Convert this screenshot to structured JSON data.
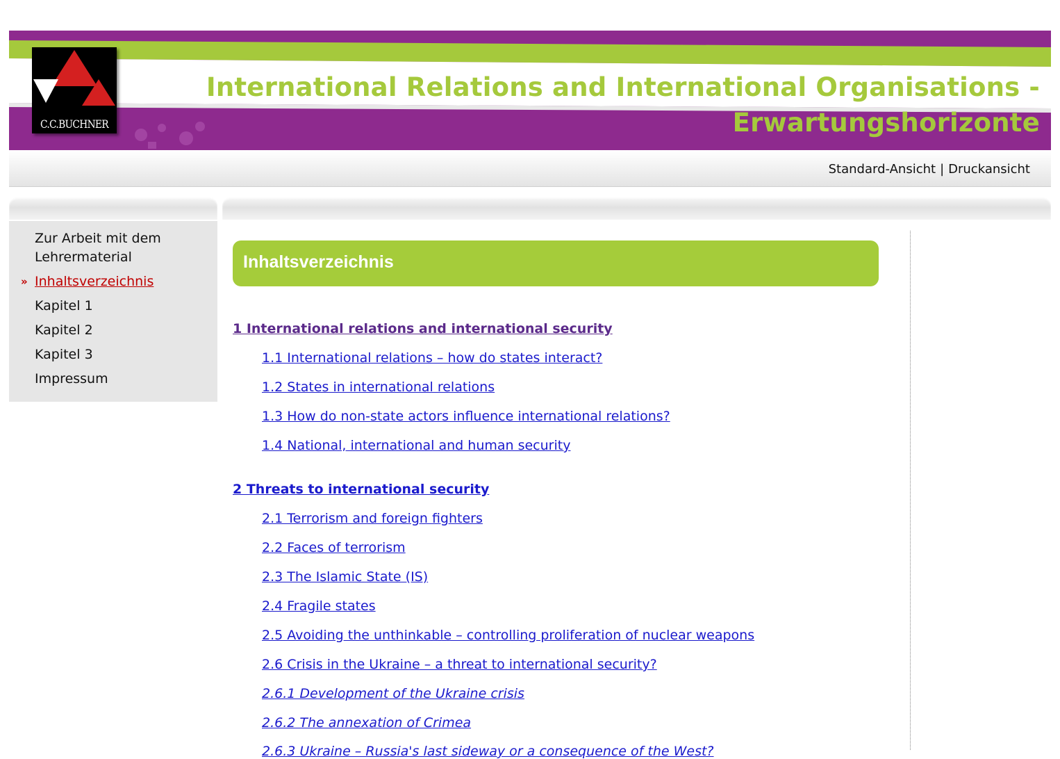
{
  "header": {
    "logo_text": "C.C.BUCHNER",
    "title_line1": "International Relations and International Organisations -",
    "title_line2": "Erwartungshorizonte",
    "colors": {
      "purple": "#8e2a8e",
      "lime": "#a5c93c"
    }
  },
  "viewbar": {
    "standard": "Standard-Ansicht",
    "separator": "|",
    "print": "Druckansicht"
  },
  "sidebar": {
    "items": [
      {
        "label": "Zur Arbeit mit dem Lehrermaterial",
        "active": false
      },
      {
        "label": "Inhaltsverzeichnis",
        "active": true,
        "marker": "»"
      },
      {
        "label": "Kapitel 1",
        "active": false
      },
      {
        "label": "Kapitel 2",
        "active": false
      },
      {
        "label": "Kapitel 3",
        "active": false
      },
      {
        "label": "Impressum",
        "active": false
      }
    ]
  },
  "content": {
    "heading": "Inhaltsverzeichnis",
    "toc": [
      {
        "label": "1 International relations and international security"
      },
      {
        "label": "1.1 International relations – how do states interact?"
      },
      {
        "label": "1.2 States in international relations"
      },
      {
        "label": "1.3 How do non-state actors influence international relations?"
      },
      {
        "label": "1.4 National, international and human security"
      },
      {
        "label": "2 Threats to international security"
      },
      {
        "label": "2.1 Terrorism and foreign fighters"
      },
      {
        "label": "2.2 Faces of terrorism"
      },
      {
        "label": "2.3 The Islamic State (IS)"
      },
      {
        "label": "2.4 Fragile states"
      },
      {
        "label": "2.5 Avoiding the unthinkable – controlling proliferation of nuclear weapons"
      },
      {
        "label": "2.6 Crisis in the Ukraine – a threat to international security?"
      },
      {
        "label": "2.6.1 Development of the Ukraine crisis"
      },
      {
        "label": "2.6.2 The annexation of Crimea"
      },
      {
        "label": "2.6.3 Ukraine – Russia's last sideway or a consequence of the West?"
      }
    ]
  }
}
